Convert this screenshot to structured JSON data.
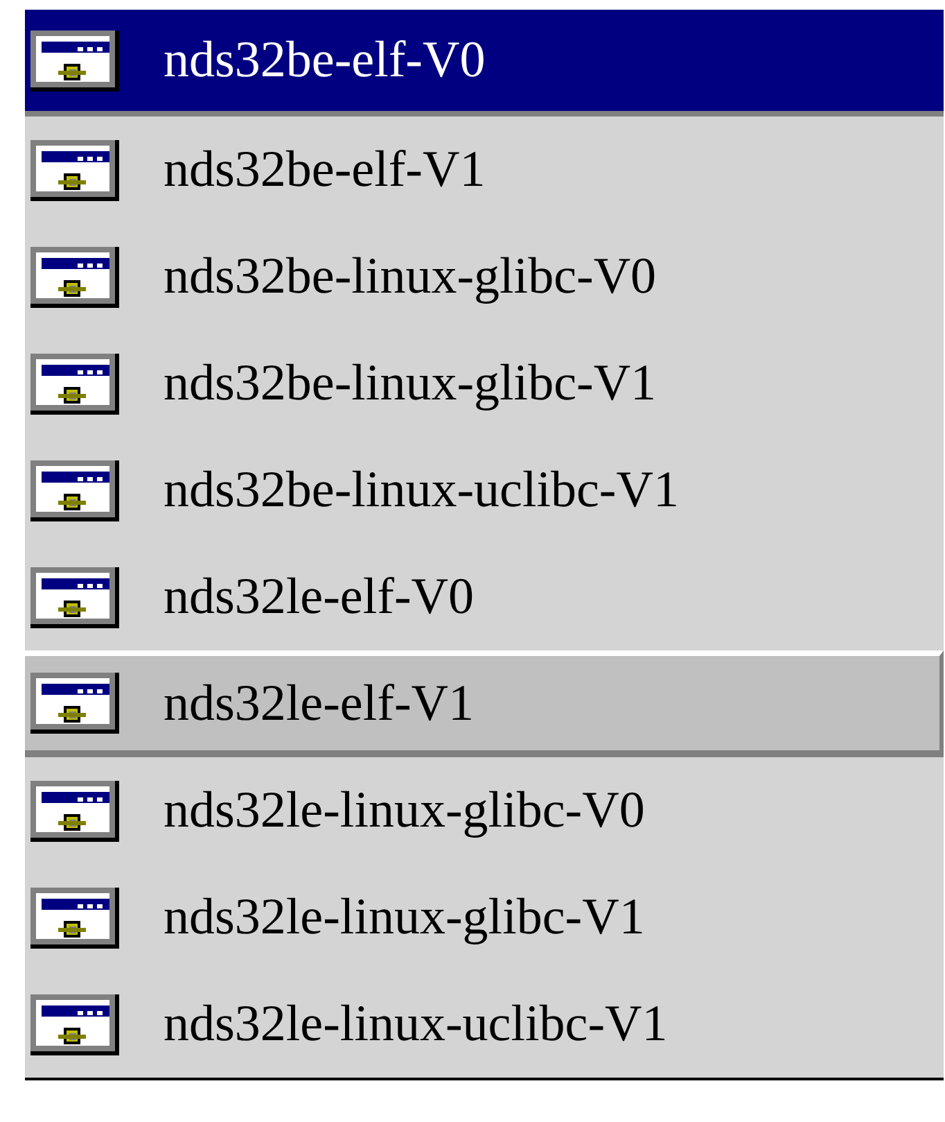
{
  "items": [
    {
      "label": "nds32be-elf-V0",
      "selected": true,
      "hovered": false
    },
    {
      "label": "nds32be-elf-V1",
      "selected": false,
      "hovered": false
    },
    {
      "label": "nds32be-linux-glibc-V0",
      "selected": false,
      "hovered": false
    },
    {
      "label": "nds32be-linux-glibc-V1",
      "selected": false,
      "hovered": false
    },
    {
      "label": "nds32be-linux-uclibc-V1",
      "selected": false,
      "hovered": false
    },
    {
      "label": "nds32le-elf-V0",
      "selected": false,
      "hovered": false
    },
    {
      "label": "nds32le-elf-V1",
      "selected": false,
      "hovered": true
    },
    {
      "label": "nds32le-linux-glibc-V0",
      "selected": false,
      "hovered": false
    },
    {
      "label": "nds32le-linux-glibc-V1",
      "selected": false,
      "hovered": false
    },
    {
      "label": "nds32le-linux-uclibc-V1",
      "selected": false,
      "hovered": false
    }
  ]
}
